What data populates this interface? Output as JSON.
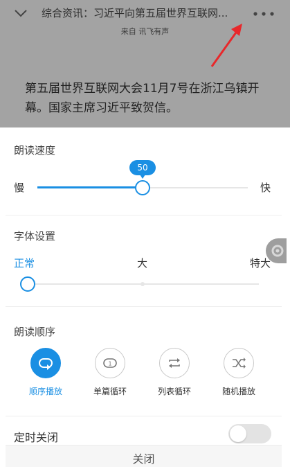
{
  "header": {
    "title": "综合资讯：习近平向第五届世界互联网...",
    "source": "来自 讯飞有声",
    "article_text": "第五届世界互联网大会11月7号在浙江乌镇开幕。国家主席习近平致贺信。"
  },
  "speed": {
    "title": "朗读速度",
    "slow_label": "慢",
    "fast_label": "快",
    "value": "50",
    "fraction": 0.5
  },
  "font": {
    "title": "字体设置",
    "options": [
      "正常",
      "大",
      "特大"
    ],
    "selected_index": 0
  },
  "order": {
    "title": "朗读顺序",
    "items": [
      {
        "label": "顺序播放",
        "icon": "sequential-play-icon",
        "active": true
      },
      {
        "label": "单篇循环",
        "icon": "repeat-one-icon",
        "active": false
      },
      {
        "label": "列表循环",
        "icon": "repeat-list-icon",
        "active": false
      },
      {
        "label": "随机播放",
        "icon": "shuffle-icon",
        "active": false
      }
    ]
  },
  "timer": {
    "label": "定时关闭",
    "enabled": false
  },
  "close_label": "关闭",
  "colors": {
    "accent": "#1a8fe3",
    "overlay": "#a3a3a3",
    "annotation_arrow": "#e8282b"
  }
}
